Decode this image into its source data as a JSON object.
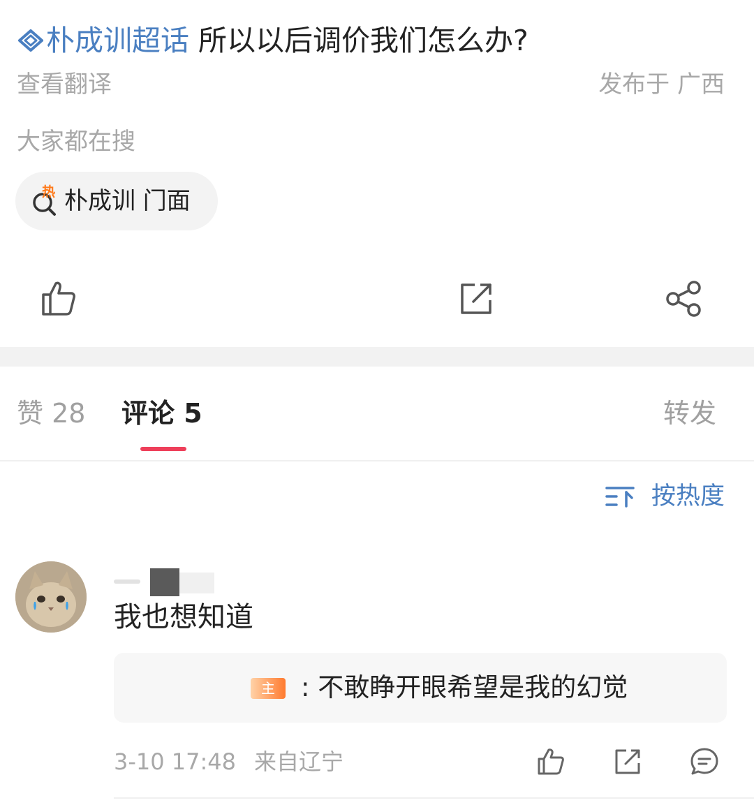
{
  "post": {
    "topic": "朴成训超话",
    "text": "所以以后调价我们怎么办?",
    "translate_label": "查看翻译",
    "location": "发布于 广西"
  },
  "search": {
    "heading": "大家都在搜",
    "hot_badge": "热",
    "query": "朴成训 门面"
  },
  "actions": {
    "like_icon": "thumbs-up-icon",
    "repost_icon": "repost-icon",
    "share_icon": "share-icon"
  },
  "tabs": {
    "likes": "赞 28",
    "comments": "评论 5",
    "reposts": "转发"
  },
  "sort": {
    "label": "按热度",
    "icon": "sort-icon"
  },
  "comments": [
    {
      "text": "我也想知道",
      "reply_badge": "主",
      "reply_text": ": 不敢睁开眼希望是我的幻觉",
      "time": "3-10 17:48",
      "location": "来自辽宁"
    }
  ],
  "colors": {
    "link": "#4a7fc1",
    "accent": "#ee3f5a",
    "muted": "#a8a8a8",
    "hot": "#ff7a1a"
  }
}
